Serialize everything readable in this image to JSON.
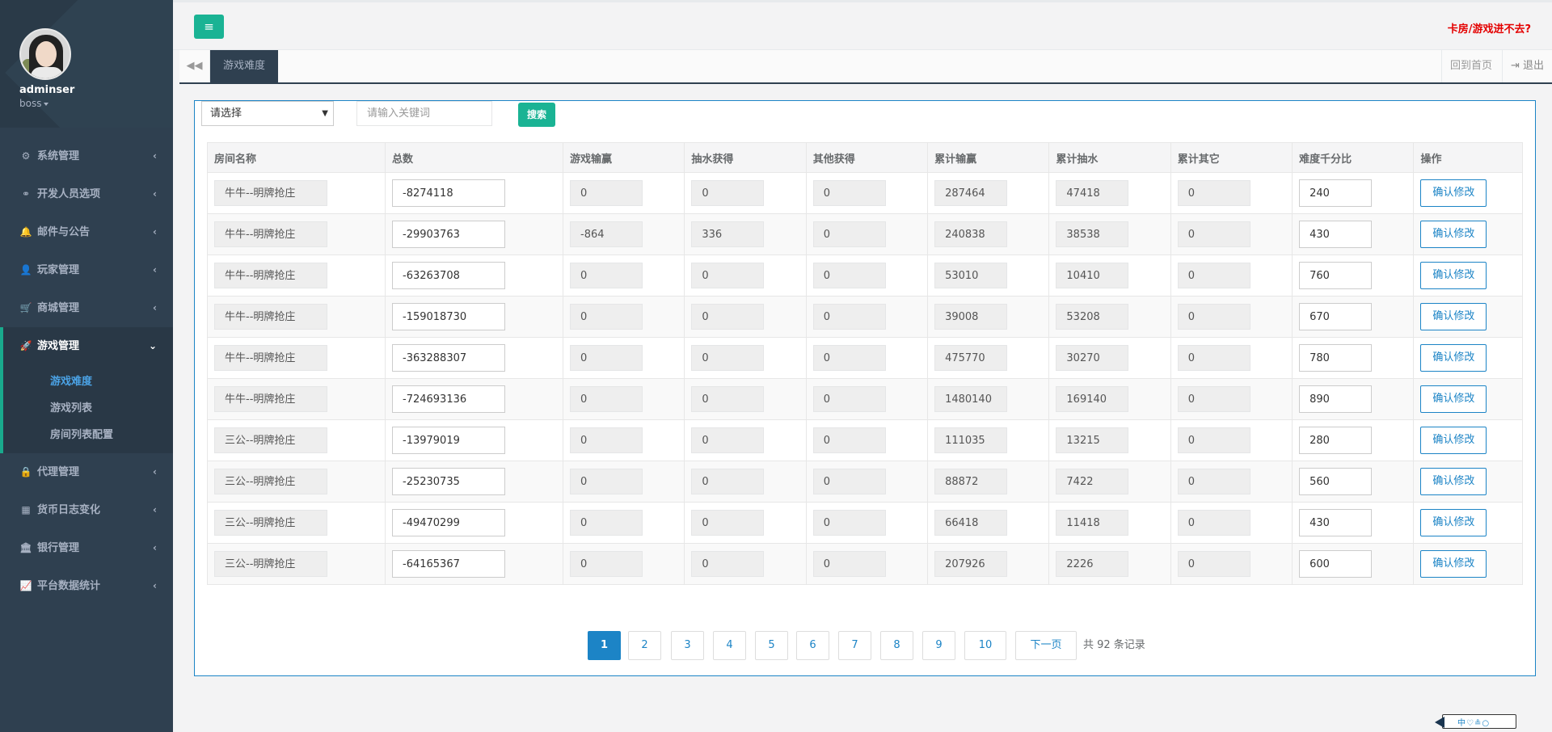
{
  "user": {
    "name": "adminser",
    "role": "boss"
  },
  "sidebar": {
    "items": [
      {
        "label": "系统管理",
        "icon": "gears-icon",
        "glyph": "⚙"
      },
      {
        "label": "开发人员选项",
        "icon": "link-icon",
        "glyph": "⚭"
      },
      {
        "label": "邮件与公告",
        "icon": "bell-icon",
        "glyph": "🔔"
      },
      {
        "label": "玩家管理",
        "icon": "user-icon",
        "glyph": "👤"
      },
      {
        "label": "商城管理",
        "icon": "cart-icon",
        "glyph": "🛒"
      },
      {
        "label": "游戏管理",
        "icon": "rocket-icon",
        "glyph": "🚀"
      },
      {
        "label": "代理管理",
        "icon": "lock-icon",
        "glyph": "🔒"
      },
      {
        "label": "货币日志变化",
        "icon": "calendar-icon",
        "glyph": "▦"
      },
      {
        "label": "银行管理",
        "icon": "bank-icon",
        "glyph": "🏛"
      },
      {
        "label": "平台数据统计",
        "icon": "line-chart-icon",
        "glyph": "📈"
      }
    ],
    "sub_items": [
      "游戏难度",
      "游戏列表",
      "房间列表配置"
    ]
  },
  "header": {
    "menu_glyph": "≡",
    "notice": "卡房/游戏进不去?"
  },
  "tabs": {
    "back_glyph": "◀◀",
    "active": "游戏难度",
    "home": "回到首页",
    "exit": "⇥ 退出"
  },
  "search": {
    "select_value": "请选择",
    "keyword_placeholder": "请输入关键词",
    "button": "搜索"
  },
  "table": {
    "headers": [
      "房间名称",
      "总数",
      "游戏输赢",
      "抽水获得",
      "其他获得",
      "累计输赢",
      "累计抽水",
      "累计其它",
      "难度千分比",
      "操作"
    ],
    "action_label": "确认修改",
    "rows": [
      [
        "牛牛--明牌抢庄",
        "-8274118",
        "0",
        "0",
        "0",
        "287464",
        "47418",
        "0",
        "240"
      ],
      [
        "牛牛--明牌抢庄",
        "-29903763",
        "-864",
        "336",
        "0",
        "240838",
        "38538",
        "0",
        "430"
      ],
      [
        "牛牛--明牌抢庄",
        "-63263708",
        "0",
        "0",
        "0",
        "53010",
        "10410",
        "0",
        "760"
      ],
      [
        "牛牛--明牌抢庄",
        "-159018730",
        "0",
        "0",
        "0",
        "39008",
        "53208",
        "0",
        "670"
      ],
      [
        "牛牛--明牌抢庄",
        "-363288307",
        "0",
        "0",
        "0",
        "475770",
        "30270",
        "0",
        "780"
      ],
      [
        "牛牛--明牌抢庄",
        "-724693136",
        "0",
        "0",
        "0",
        "1480140",
        "169140",
        "0",
        "890"
      ],
      [
        "三公--明牌抢庄",
        "-13979019",
        "0",
        "0",
        "0",
        "111035",
        "13215",
        "0",
        "280"
      ],
      [
        "三公--明牌抢庄",
        "-25230735",
        "0",
        "0",
        "0",
        "88872",
        "7422",
        "0",
        "560"
      ],
      [
        "三公--明牌抢庄",
        "-49470299",
        "0",
        "0",
        "0",
        "66418",
        "11418",
        "0",
        "430"
      ],
      [
        "三公--明牌抢庄",
        "-64165367",
        "0",
        "0",
        "0",
        "207926",
        "2226",
        "0",
        "600"
      ]
    ]
  },
  "pagination": {
    "pages": [
      "1",
      "2",
      "3",
      "4",
      "5",
      "6",
      "7",
      "8",
      "9",
      "10"
    ],
    "current": "1",
    "next": "下一页",
    "total_text": "共 92 条记录"
  },
  "footer": {
    "logo_text": "中♡≗○"
  }
}
